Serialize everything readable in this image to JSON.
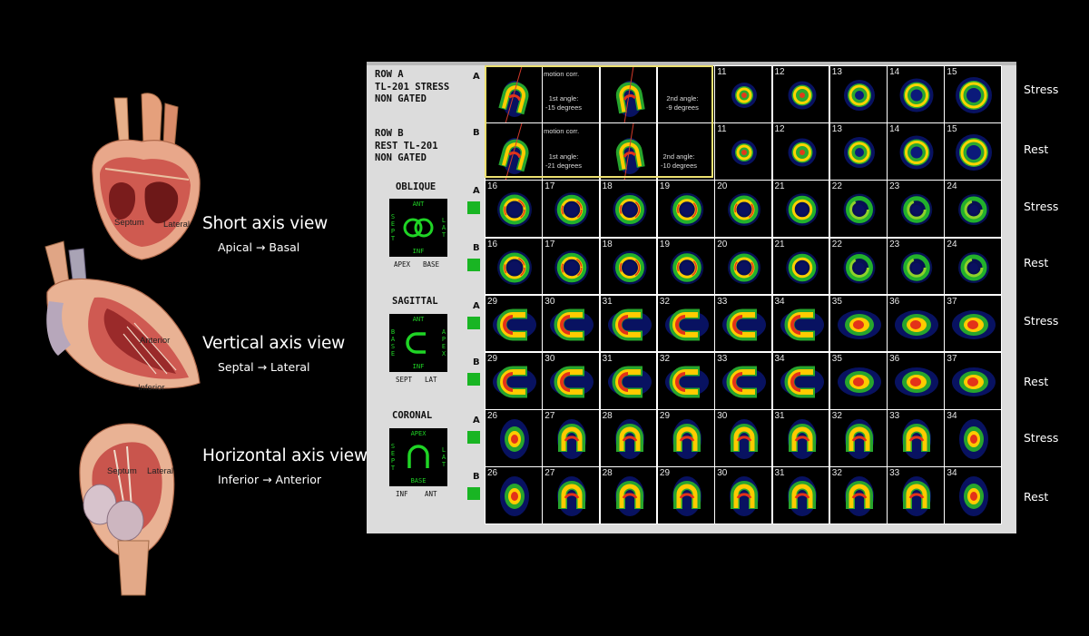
{
  "views": [
    {
      "title": "Short axis view",
      "subtitle": "Apical → Basal",
      "labels": [
        "Septum",
        "Lateral"
      ]
    },
    {
      "title": "Vertical axis view",
      "subtitle": "Septal → Lateral",
      "labels": [
        "Anterior",
        "Inferior"
      ]
    },
    {
      "title": "Horizontal axis view",
      "subtitle": "Inferior → Anterior",
      "labels": [
        "Septum",
        "Lateral"
      ]
    }
  ],
  "panel": {
    "row_a": [
      "ROW A",
      "TL-201 STRESS",
      "NON GATED"
    ],
    "row_b": [
      "ROW B",
      "REST TL-201",
      "NON GATED"
    ],
    "row_letter_a": "A",
    "row_letter_b": "B",
    "motion": {
      "label": "motion corr.",
      "stress_first": [
        "1st angle:",
        "-15 degrees"
      ],
      "stress_second": [
        "2nd angle:",
        "-9 degrees"
      ],
      "rest_first": [
        "1st angle:",
        "-21 degrees"
      ],
      "rest_second": [
        "2nd angle:",
        "-10 degrees"
      ]
    },
    "sections": [
      {
        "title": "OBLIQUE",
        "top": "ANT",
        "bottom": "INF",
        "left": "SEPT",
        "right": "LAT",
        "under_left": "APEX",
        "under_right": "BASE"
      },
      {
        "title": "SAGITTAL",
        "top": "ANT",
        "bottom": "INF",
        "left": "BASE",
        "right": "APEX",
        "under_left": "SEPT",
        "under_right": "LAT"
      },
      {
        "title": "CORONAL",
        "top": "APEX",
        "bottom": "BASE",
        "left": "SEPT",
        "right": "LAT",
        "under_left": "INF",
        "under_right": "ANT"
      }
    ],
    "rows": [
      {
        "side": "Stress",
        "shape": "sa",
        "numbers": [
          "11",
          "12",
          "13",
          "14",
          "15"
        ]
      },
      {
        "side": "Rest",
        "shape": "sa",
        "numbers": [
          "11",
          "12",
          "13",
          "14",
          "15"
        ]
      },
      {
        "side": "Stress",
        "shape": "ring",
        "numbers": [
          "16",
          "17",
          "18",
          "19",
          "20",
          "21",
          "22",
          "23",
          "24"
        ]
      },
      {
        "side": "Rest",
        "shape": "ring",
        "numbers": [
          "16",
          "17",
          "18",
          "19",
          "20",
          "21",
          "22",
          "23",
          "24"
        ]
      },
      {
        "side": "Stress",
        "shape": "horse",
        "numbers": [
          "29",
          "30",
          "31",
          "32",
          "33",
          "34",
          "35",
          "36",
          "37"
        ]
      },
      {
        "side": "Rest",
        "shape": "horse",
        "numbers": [
          "29",
          "30",
          "31",
          "32",
          "33",
          "34",
          "35",
          "36",
          "37"
        ]
      },
      {
        "side": "Stress",
        "shape": "arch",
        "numbers": [
          "26",
          "27",
          "28",
          "29",
          "30",
          "31",
          "32",
          "33",
          "34"
        ]
      },
      {
        "side": "Rest",
        "shape": "arch",
        "numbers": [
          "26",
          "27",
          "28",
          "29",
          "30",
          "31",
          "32",
          "33",
          "34"
        ]
      }
    ]
  },
  "colors": {
    "accent_green": "#19b523",
    "orient_green": "#1fd425",
    "motion_border": "#ece070"
  }
}
